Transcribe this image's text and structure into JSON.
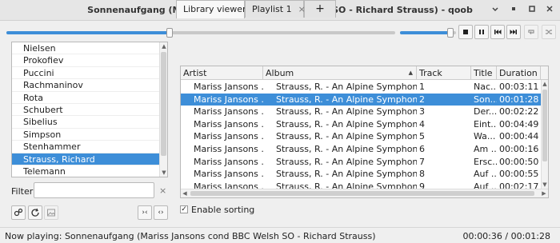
{
  "window": {
    "title": "Sonnenaufgang (Mariss Jansons cond BBC Welsh SO - Richard Strauss) - qoob"
  },
  "player": {
    "seek_progress": 0.42,
    "volume_level": 0.9
  },
  "artists": [
    "Nielsen",
    "Prokofiev",
    "Puccini",
    "Rachmaninov",
    "Rota",
    "Schubert",
    "Sibelius",
    "Simpson",
    "Stenhammer",
    "Strauss, Richard",
    "Telemann"
  ],
  "artists_selected": "Strauss, Richard",
  "filter": {
    "label": "Filter",
    "value": "",
    "clear_glyph": "×"
  },
  "side_buttons": {
    "collapse": "›‹",
    "expand": "‹›"
  },
  "tabs": [
    {
      "label": "Library viewer",
      "active": true
    },
    {
      "label": "Playlist 1",
      "active": false,
      "close": "×"
    },
    {
      "label": "+",
      "add": true
    }
  ],
  "table": {
    "columns": [
      "Artist",
      "Album",
      "Track",
      "Title",
      "Duration"
    ],
    "rows": [
      {
        "artist": "Mariss Jansons ...",
        "album": "Strauss, R. - An Alpine Symphony",
        "track": "1",
        "title": "Nac...",
        "duration": "00:03:11"
      },
      {
        "artist": "Mariss Jansons ...",
        "album": "Strauss, R. - An Alpine Symphony",
        "track": "2",
        "title": "Son...",
        "duration": "00:01:28",
        "selected": true
      },
      {
        "artist": "Mariss Jansons ...",
        "album": "Strauss, R. - An Alpine Symphony",
        "track": "3",
        "title": "Der...",
        "duration": "00:02:22"
      },
      {
        "artist": "Mariss Jansons ...",
        "album": "Strauss, R. - An Alpine Symphony",
        "track": "4",
        "title": "Eint...",
        "duration": "00:04:49"
      },
      {
        "artist": "Mariss Jansons ...",
        "album": "Strauss, R. - An Alpine Symphony",
        "track": "5",
        "title": "Wa...",
        "duration": "00:00:44"
      },
      {
        "artist": "Mariss Jansons ...",
        "album": "Strauss, R. - An Alpine Symphony",
        "track": "6",
        "title": "Am ...",
        "duration": "00:00:16"
      },
      {
        "artist": "Mariss Jansons ...",
        "album": "Strauss, R. - An Alpine Symphony",
        "track": "7",
        "title": "Ersc...",
        "duration": "00:00:50"
      },
      {
        "artist": "Mariss Jansons ...",
        "album": "Strauss, R. - An Alpine Symphony",
        "track": "8",
        "title": "Auf ...",
        "duration": "00:00:55"
      },
      {
        "artist": "Mariss Jansons ...",
        "album": "Strauss, R. - An Alpine Symphony",
        "track": "9",
        "title": "Auf ...",
        "duration": "00:02:17"
      }
    ]
  },
  "sorting": {
    "label": "Enable sorting",
    "checked": true,
    "check_glyph": "✓"
  },
  "status": {
    "now_playing": "Now playing: Sonnenaufgang (Mariss Jansons cond BBC Welsh SO - Richard Strauss)",
    "time": "00:00:36 / 00:01:28"
  },
  "colors": {
    "accent": "#3d8ed8",
    "selection_text": "#ffffff"
  },
  "icons": {
    "window": [
      "close-icon",
      "minimize-icon",
      "maximize-icon",
      "close-window-icon"
    ],
    "transport": [
      "stop-icon",
      "pause-icon",
      "previous-icon",
      "next-icon",
      "repeat-icon",
      "shuffle-icon"
    ],
    "side": [
      "settings-icon",
      "refresh-icon",
      "image-icon"
    ]
  }
}
